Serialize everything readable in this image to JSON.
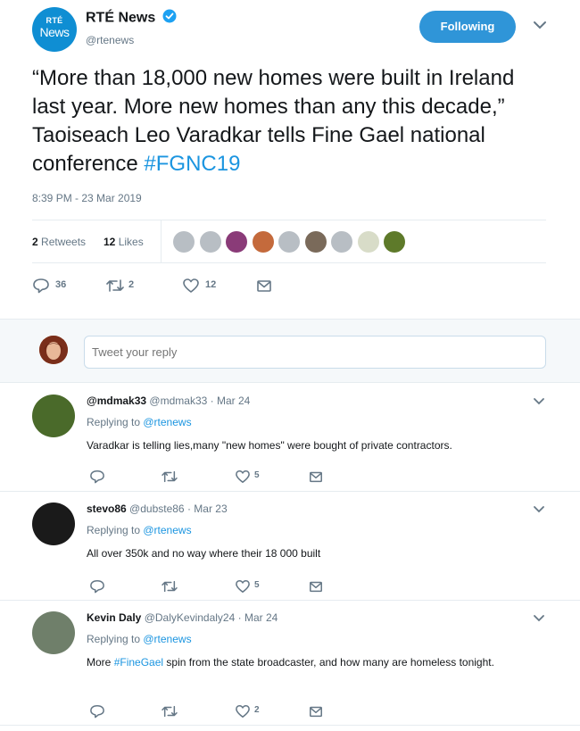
{
  "tweet": {
    "avatar_line1": "RTÉ",
    "avatar_line2": "News",
    "display_name": "RTÉ News",
    "handle": "@rtenews",
    "follow_label": "Following",
    "text_main": "“More than 18,000 new homes were built in Ireland last year. More new homes than any this decade,” Taoiseach Leo Varadkar tells Fine Gael national conference ",
    "text_hashtag": "#FGNC19",
    "timestamp": "8:39 PM - 23 Mar 2019",
    "retweets_count": "2",
    "retweets_label": "Retweets",
    "likes_count": "12",
    "likes_label": "Likes",
    "liker_colors": [
      "#b8bec4",
      "#b8bec4",
      "#8a3b78",
      "#c46a3c",
      "#b8bec4",
      "#7a6a5a",
      "#b8bec4",
      "#d8dcc8",
      "#5e7a2a"
    ],
    "actions": {
      "reply_count": "36",
      "retweet_count": "2",
      "like_count": "12"
    }
  },
  "reply_box": {
    "placeholder": "Tweet your reply"
  },
  "replies": [
    {
      "name": "@mdmak33",
      "handle": "@mdmak33",
      "date": "· Mar 24",
      "replying_prefix": "Replying to ",
      "replying_to": "@rtenews",
      "text": "Varadkar is telling lies,many \"new homes\" were bought of private contractors.",
      "hashtag": "",
      "text_rest": "",
      "like_count": "5",
      "avatar_color": "#4a6a2a"
    },
    {
      "name": "stevo86",
      "handle": "@dubste86",
      "date": "· Mar 23",
      "replying_prefix": "Replying to ",
      "replying_to": "@rtenews",
      "text": "All over 350k and no way where their 18 000 built",
      "hashtag": "",
      "text_rest": "",
      "like_count": "5",
      "avatar_color": "#1a1a1a"
    },
    {
      "name": "Kevin Daly",
      "handle": "@DalyKevindaly24",
      "date": "· Mar 24",
      "replying_prefix": "Replying to ",
      "replying_to": "@rtenews",
      "text": "More ",
      "hashtag": "#FineGael",
      "text_rest": " spin from the state broadcaster, and how many are homeless tonight.",
      "like_count": "2",
      "avatar_color": "#6f7f6a"
    }
  ]
}
